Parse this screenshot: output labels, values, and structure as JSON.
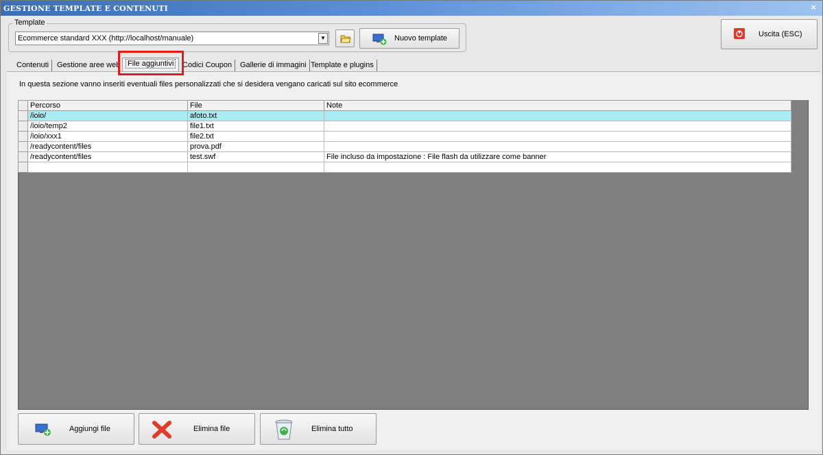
{
  "window": {
    "title": "GESTIONE TEMPLATE E CONTENUTI",
    "close_glyph": "×"
  },
  "template_group": {
    "legend": "Template",
    "selected": "Ecommerce standard XXX (http://localhost/manuale)",
    "new_button": "Nuovo template"
  },
  "exit_button": "Uscita (ESC)",
  "tabs": [
    {
      "label": "Contenuti"
    },
    {
      "label": "Gestione aree web"
    },
    {
      "label": "File aggiuntivi",
      "active": true
    },
    {
      "label": "Codici Coupon"
    },
    {
      "label": "Gallerie di immagini"
    },
    {
      "label": "Template e plugins"
    }
  ],
  "description": "In questa sezione vanno inseriti eventuali files personalizzati che si desidera vengano caricati sul sito ecommerce",
  "grid": {
    "columns": [
      "Percorso",
      "File",
      "Note"
    ],
    "rows": [
      {
        "percorso": "/ioio/",
        "file": "afoto.txt",
        "note": ""
      },
      {
        "percorso": "/ioio/temp2",
        "file": "file1.txt",
        "note": ""
      },
      {
        "percorso": "/ioio/xxx1",
        "file": "file2.txt",
        "note": ""
      },
      {
        "percorso": "/readycontent/files",
        "file": "prova.pdf",
        "note": ""
      },
      {
        "percorso": "/readycontent/files",
        "file": "test.swf",
        "note": "File incluso da impostazione : File flash da utilizzare come banner"
      },
      {
        "percorso": "",
        "file": "",
        "note": ""
      }
    ],
    "selected_row": 0
  },
  "bottom_buttons": {
    "add": "Aggiungi file",
    "delete": "Elimina file",
    "delete_all": "Elimina tutto"
  },
  "icons": {
    "folder": "folder-open-icon",
    "new_template": "monitor-add-icon",
    "exit": "power-icon",
    "add": "monitor-add-icon",
    "delete": "red-x-icon",
    "delete_all": "recycle-bin-icon"
  }
}
